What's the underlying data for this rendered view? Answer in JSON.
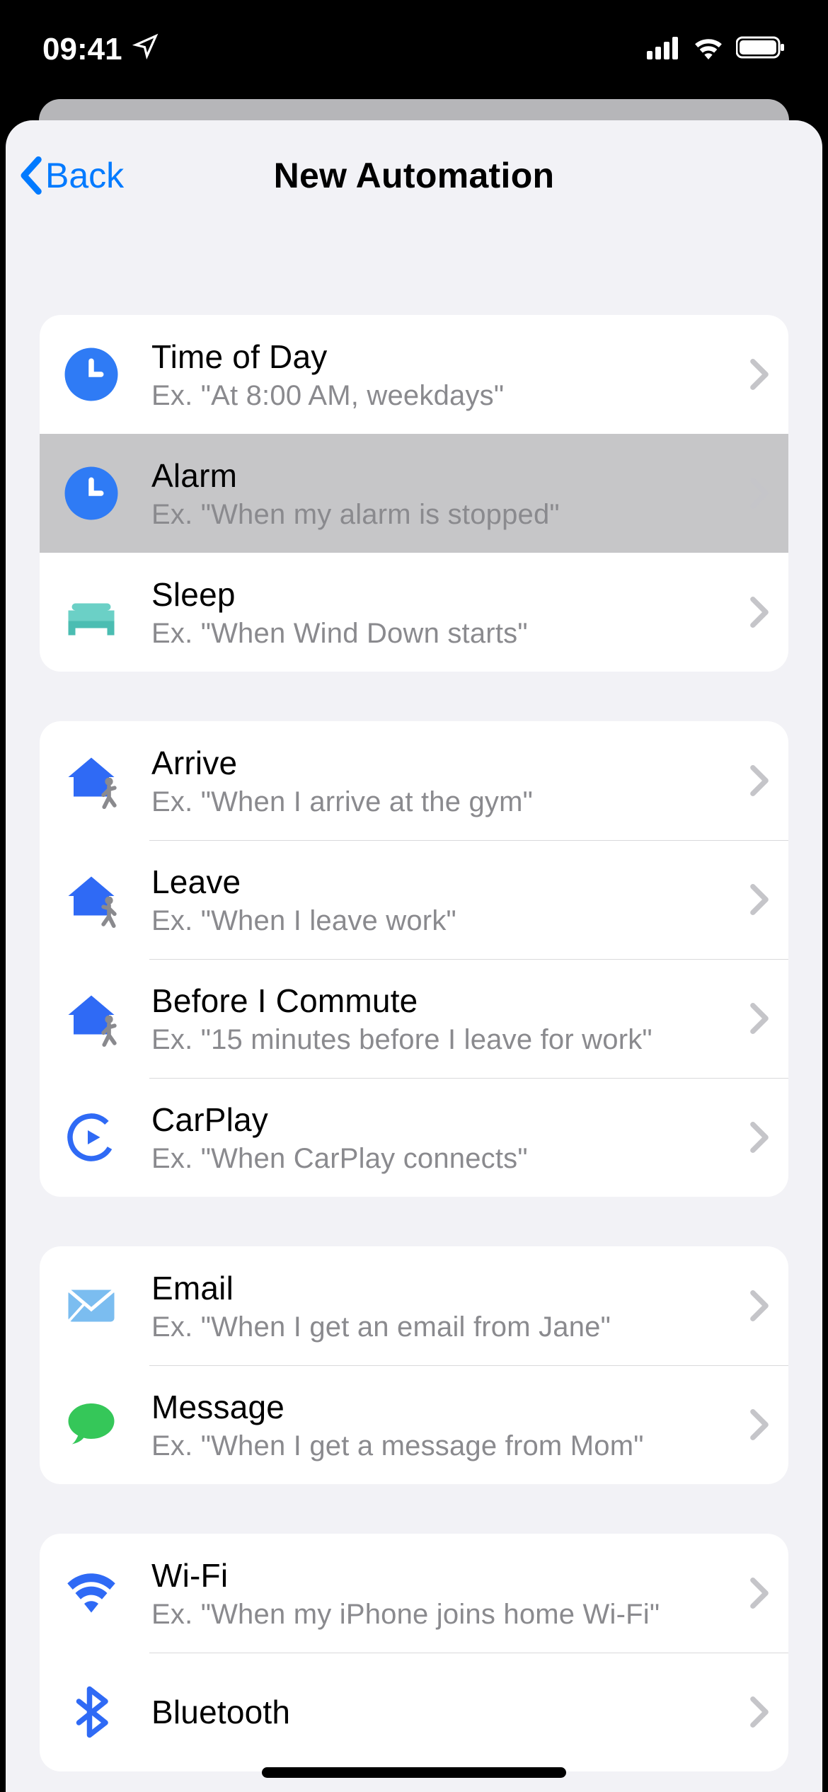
{
  "status": {
    "time": "09:41"
  },
  "nav": {
    "back_label": "Back",
    "title": "New Automation"
  },
  "sections": [
    {
      "rows": [
        {
          "icon": "clock-icon",
          "title": "Time of Day",
          "sub": "Ex. \"At 8:00 AM, weekdays\"",
          "highlight": false
        },
        {
          "icon": "clock-icon",
          "title": "Alarm",
          "sub": "Ex. \"When my alarm is stopped\"",
          "highlight": true
        },
        {
          "icon": "bed-icon",
          "title": "Sleep",
          "sub": "Ex. \"When Wind Down starts\"",
          "highlight": false
        }
      ]
    },
    {
      "rows": [
        {
          "icon": "arrive-icon",
          "title": "Arrive",
          "sub": "Ex. \"When I arrive at the gym\"",
          "highlight": false
        },
        {
          "icon": "leave-icon",
          "title": "Leave",
          "sub": "Ex. \"When I leave work\"",
          "highlight": false
        },
        {
          "icon": "commute-icon",
          "title": "Before I Commute",
          "sub": "Ex. \"15 minutes before I leave for work\"",
          "highlight": false
        },
        {
          "icon": "carplay-icon",
          "title": "CarPlay",
          "sub": "Ex. \"When CarPlay connects\"",
          "highlight": false
        }
      ]
    },
    {
      "rows": [
        {
          "icon": "email-icon",
          "title": "Email",
          "sub": "Ex. \"When I get an email from Jane\"",
          "highlight": false
        },
        {
          "icon": "message-icon",
          "title": "Message",
          "sub": "Ex. \"When I get a message from Mom\"",
          "highlight": false
        }
      ]
    },
    {
      "rows": [
        {
          "icon": "wifi-icon",
          "title": "Wi-Fi",
          "sub": "Ex. \"When my iPhone joins home Wi-Fi\"",
          "highlight": false
        },
        {
          "icon": "bluetooth-icon",
          "title": "Bluetooth",
          "sub": "",
          "highlight": false
        }
      ]
    }
  ],
  "colors": {
    "ios_blue": "#007aff",
    "teal": "#6bd0c6",
    "sky": "#7bbdf0",
    "green": "#35c759",
    "grey": "#8a8a8e"
  }
}
